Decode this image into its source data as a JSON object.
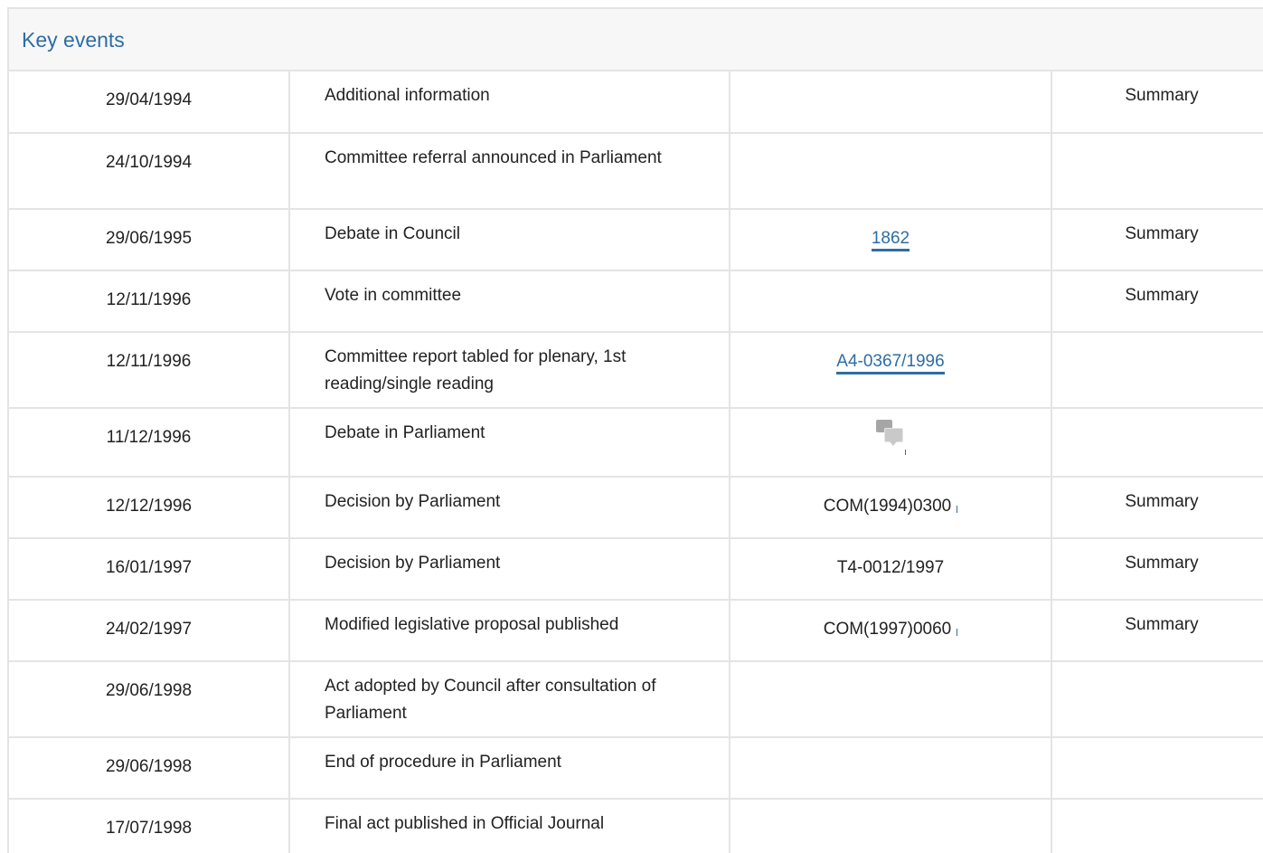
{
  "panel": {
    "title": "Key events"
  },
  "rows": [
    {
      "date": "29/04/1994",
      "event": "Additional information",
      "doc": "",
      "summary": "Summary"
    },
    {
      "date": "24/10/1994",
      "event": "Committee referral announced in Parliament",
      "doc": "",
      "summary": ""
    },
    {
      "date": "29/06/1995",
      "event": "Debate in Council",
      "doc": "1862",
      "summary": "Summary"
    },
    {
      "date": "12/11/1996",
      "event": "Vote in committee",
      "doc": "",
      "summary": "Summary"
    },
    {
      "date": "12/11/1996",
      "event": "Committee report tabled for plenary, 1st reading/single reading",
      "doc": "A4-0367/1996",
      "summary": ""
    },
    {
      "date": "11/12/1996",
      "event": "Debate in Parliament",
      "doc": "",
      "doc_icon": "debate-icon",
      "summary": ""
    },
    {
      "date": "12/12/1996",
      "event": "Decision by Parliament",
      "doc": "COM(1994)0300",
      "summary": "Summary"
    },
    {
      "date": "16/01/1997",
      "event": "Decision by Parliament",
      "doc": "T4-0012/1997",
      "summary": "Summary"
    },
    {
      "date": "24/02/1997",
      "event": "Modified legislative proposal published",
      "doc": "COM(1997)0060",
      "summary": "Summary"
    },
    {
      "date": "29/06/1998",
      "event": "Act adopted by Council after consultation of Parliament",
      "doc": "",
      "summary": ""
    },
    {
      "date": "29/06/1998",
      "event": "End of procedure in Parliament",
      "doc": "",
      "summary": ""
    },
    {
      "date": "17/07/1998",
      "event": "Final act published in Official Journal",
      "doc": "",
      "summary": ""
    }
  ],
  "colors": {
    "link": "#2e6da4",
    "border": "#e4e4e4",
    "header_bg": "#f7f7f7"
  }
}
